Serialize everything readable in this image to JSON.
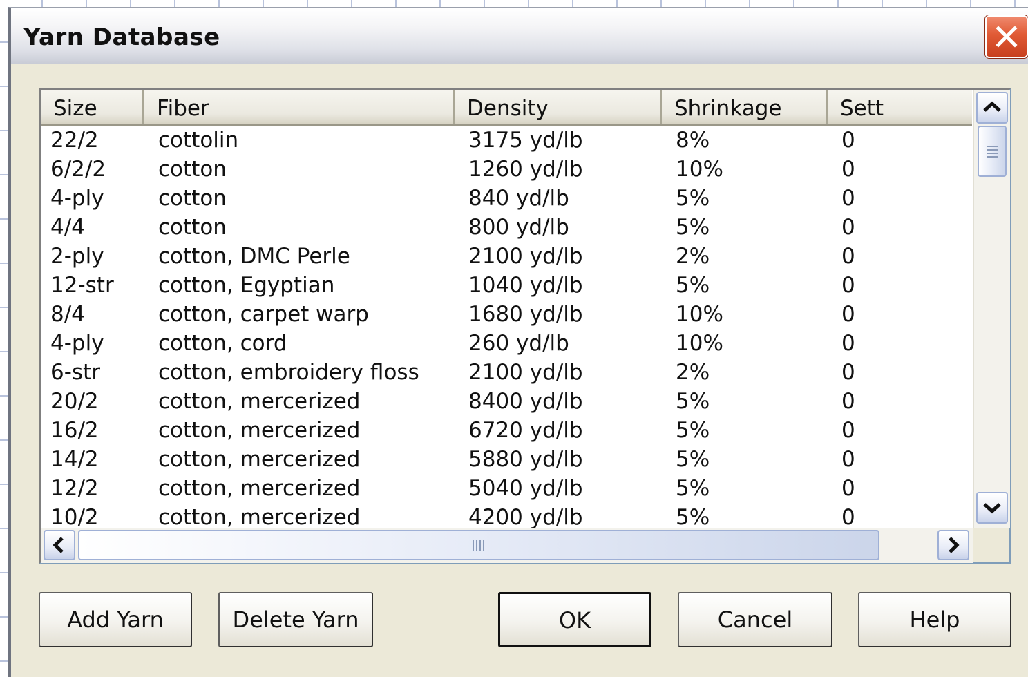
{
  "window": {
    "title": "Yarn Database"
  },
  "table": {
    "columns": [
      "Size",
      "Fiber",
      "Density",
      "Shrinkage",
      "Sett"
    ],
    "rows": [
      [
        "22/2",
        "cottolin",
        "3175 yd/lb",
        "8%",
        "0"
      ],
      [
        "6/2/2",
        "cotton",
        "1260 yd/lb",
        "10%",
        "0"
      ],
      [
        "4-ply",
        "cotton",
        "840 yd/lb",
        "5%",
        "0"
      ],
      [
        "4/4",
        "cotton",
        "800 yd/lb",
        "5%",
        "0"
      ],
      [
        "2-ply",
        "cotton, DMC Perle",
        "2100 yd/lb",
        "2%",
        "0"
      ],
      [
        "12-str",
        "cotton, Egyptian",
        "1040 yd/lb",
        "5%",
        "0"
      ],
      [
        "8/4",
        "cotton, carpet warp",
        "1680 yd/lb",
        "10%",
        "0"
      ],
      [
        "4-ply",
        "cotton, cord",
        "260 yd/lb",
        "10%",
        "0"
      ],
      [
        "6-str",
        "cotton, embroidery floss",
        "2100 yd/lb",
        "2%",
        "0"
      ],
      [
        "20/2",
        "cotton, mercerized",
        "8400 yd/lb",
        "5%",
        "0"
      ],
      [
        "16/2",
        "cotton, mercerized",
        "6720 yd/lb",
        "5%",
        "0"
      ],
      [
        "14/2",
        "cotton, mercerized",
        "5880 yd/lb",
        "5%",
        "0"
      ],
      [
        "12/2",
        "cotton, mercerized",
        "5040 yd/lb",
        "5%",
        "0"
      ],
      [
        "10/2",
        "cotton, mercerized",
        "4200 yd/lb",
        "5%",
        "0"
      ]
    ]
  },
  "buttons": {
    "add": "Add Yarn",
    "delete": "Delete Yarn",
    "ok": "OK",
    "cancel": "Cancel",
    "help": "Help"
  }
}
